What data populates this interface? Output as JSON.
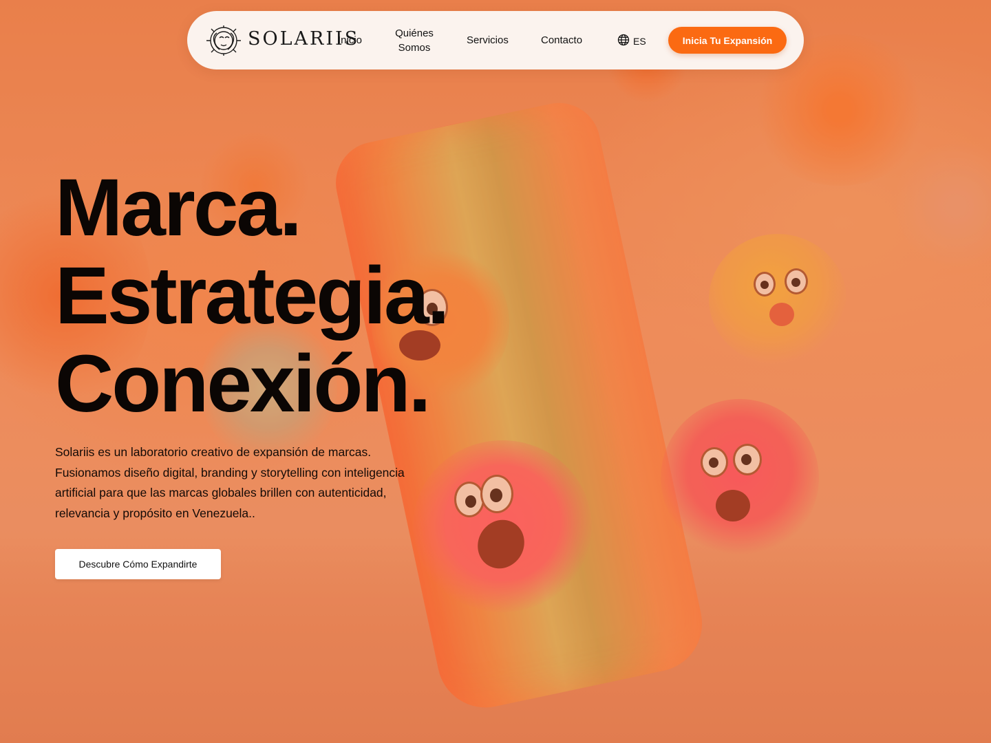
{
  "nav": {
    "brand": "SOLARIIS",
    "links": [
      "Inicio",
      "Quiénes Somos",
      "Servicios",
      "Contacto"
    ],
    "quienes_line1": "Quiénes",
    "quienes_line2": "Somos",
    "language": "ES",
    "cta_label": "Inicia Tu Expansión"
  },
  "hero": {
    "line1": "Marca.",
    "line2": "Estrategia.",
    "line3": "Conexión.",
    "description": "Solariis es un laboratorio creativo de expansión de marcas. Fusionamos diseño digital, branding y storytelling con inteligencia artificial para que las marcas globales brillen con autenticidad, relevancia y propósito en Venezuela..",
    "button_label": "Descubre Cómo Expandirte"
  },
  "colors": {
    "accent": "#fb6a12",
    "nav_bg": "#fbf3ee",
    "background": "#e8804a",
    "text": "#0b0604"
  },
  "icons": {
    "logo": "solar-face-logo-icon",
    "language": "globe-icon"
  }
}
